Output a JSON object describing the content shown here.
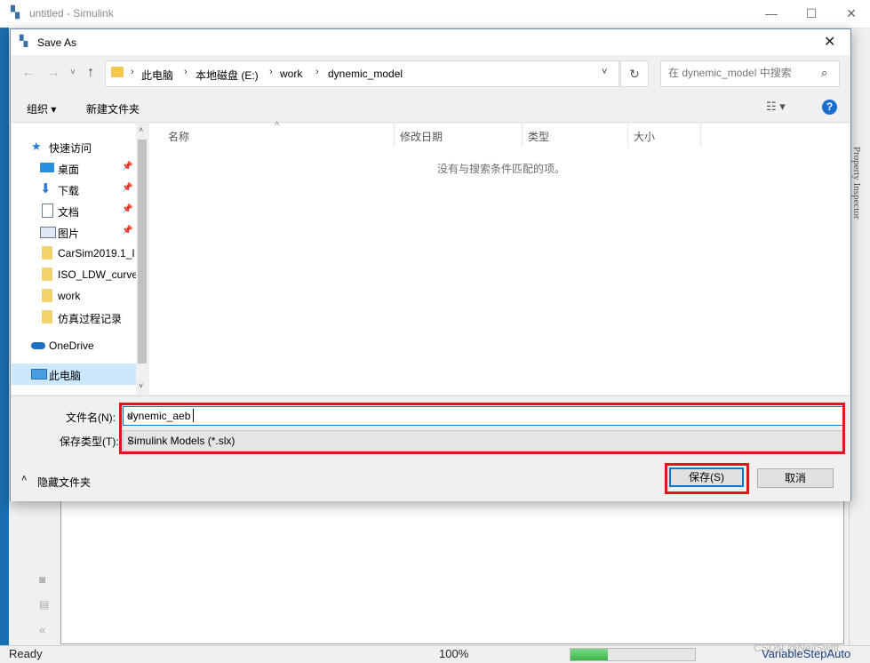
{
  "simulink": {
    "window_title": "untitled - Simulink",
    "property_inspector": "Property Inspector",
    "status": {
      "ready": "Ready",
      "zoom": "100%",
      "solver": "VariableStepAuto",
      "progress_fraction": 0.3
    },
    "watermark": "CSDN @NeilSwift"
  },
  "dialog": {
    "title": "Save As",
    "breadcrumb": [
      "此电脑",
      "本地磁盘 (E:)",
      "work",
      "dynemic_model"
    ],
    "search_placeholder": "在 dynemic_model 中搜索",
    "toolbar": {
      "organize": "组织 ▾",
      "new_folder": "新建文件夹"
    },
    "nav_items": [
      {
        "label": "快速访问",
        "icon": "star-icon",
        "pinned": false
      },
      {
        "label": "桌面",
        "icon": "desktop-icon",
        "pinned": true
      },
      {
        "label": "下载",
        "icon": "download-icon",
        "pinned": true
      },
      {
        "label": "文档",
        "icon": "document-icon",
        "pinned": true
      },
      {
        "label": "图片",
        "icon": "picture-icon",
        "pinned": true
      },
      {
        "label": "CarSim2019.1_I",
        "icon": "folder-icon",
        "pinned": false
      },
      {
        "label": "ISO_LDW_curve",
        "icon": "folder-icon",
        "pinned": false
      },
      {
        "label": "work",
        "icon": "folder-icon",
        "pinned": false
      },
      {
        "label": "仿真过程记录",
        "icon": "folder-icon",
        "pinned": false
      },
      {
        "label": "OneDrive",
        "icon": "cloud-icon",
        "pinned": false
      },
      {
        "label": "此电脑",
        "icon": "computer-icon",
        "pinned": false
      }
    ],
    "columns": [
      "名称",
      "修改日期",
      "类型",
      "大小"
    ],
    "empty_message": "没有与搜索条件匹配的项。",
    "file_name_label": "文件名(N):",
    "file_name_value": "dynemic_aeb",
    "file_type_label": "保存类型(T):",
    "file_type_value": "Simulink Models (*.slx)",
    "hide_folders": "隐藏文件夹",
    "save_label": "保存(S)",
    "cancel_label": "取消"
  },
  "colors": {
    "accent": "#0078d7",
    "highlight_red": "#e3151c",
    "progress_green": "#3db54a"
  }
}
